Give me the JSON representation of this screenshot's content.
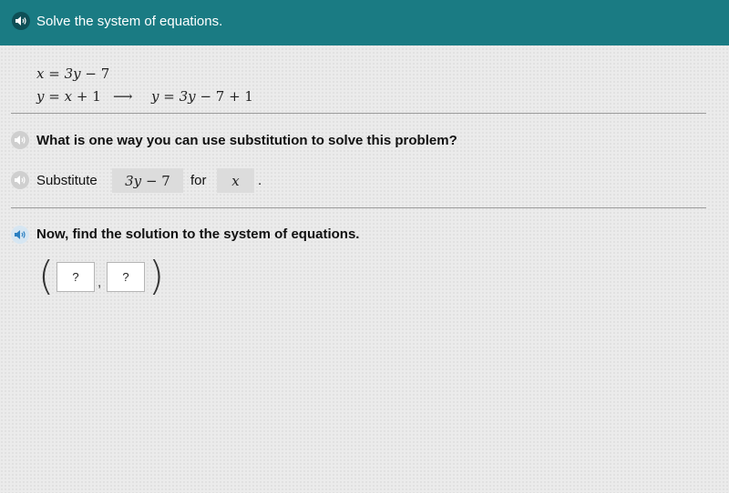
{
  "header": {
    "title": "Solve the system of equations."
  },
  "equations": {
    "line1": {
      "lhs": "x",
      "eq": "=",
      "rhs_var": "3y",
      "rhs_rest": "− 7"
    },
    "line2": {
      "lhs": "y",
      "eq": "=",
      "rhs_var": "x",
      "rhs_rest": "+ 1"
    },
    "arrow": "⟶",
    "line3": {
      "lhs": "y",
      "eq": "=",
      "rhs_var": "3y",
      "rhs_rest": "− 7 + 1"
    }
  },
  "question1": {
    "text": "What is one way you can use substitution to solve this problem?"
  },
  "answer1": {
    "prefix": "Substitute",
    "expr_var": "3y",
    "expr_rest": "− 7",
    "middle": "for",
    "target_var": "x",
    "suffix": "."
  },
  "question2": {
    "text": "Now, find the solution to the system of equations."
  },
  "solution": {
    "open_paren": "(",
    "close_paren": ")",
    "comma": ",",
    "x_placeholder": "?",
    "y_placeholder": "?"
  },
  "colors": {
    "header_bg": "#1a7b83",
    "header_icon_bg": "#0e4f56",
    "active_icon": "#2a7fc1",
    "inactive_icon": "#9a9a9a"
  },
  "icons": {
    "header": "speaker-icon",
    "question1": "speaker-icon",
    "answer1": "speaker-icon",
    "question2": "speaker-icon"
  }
}
